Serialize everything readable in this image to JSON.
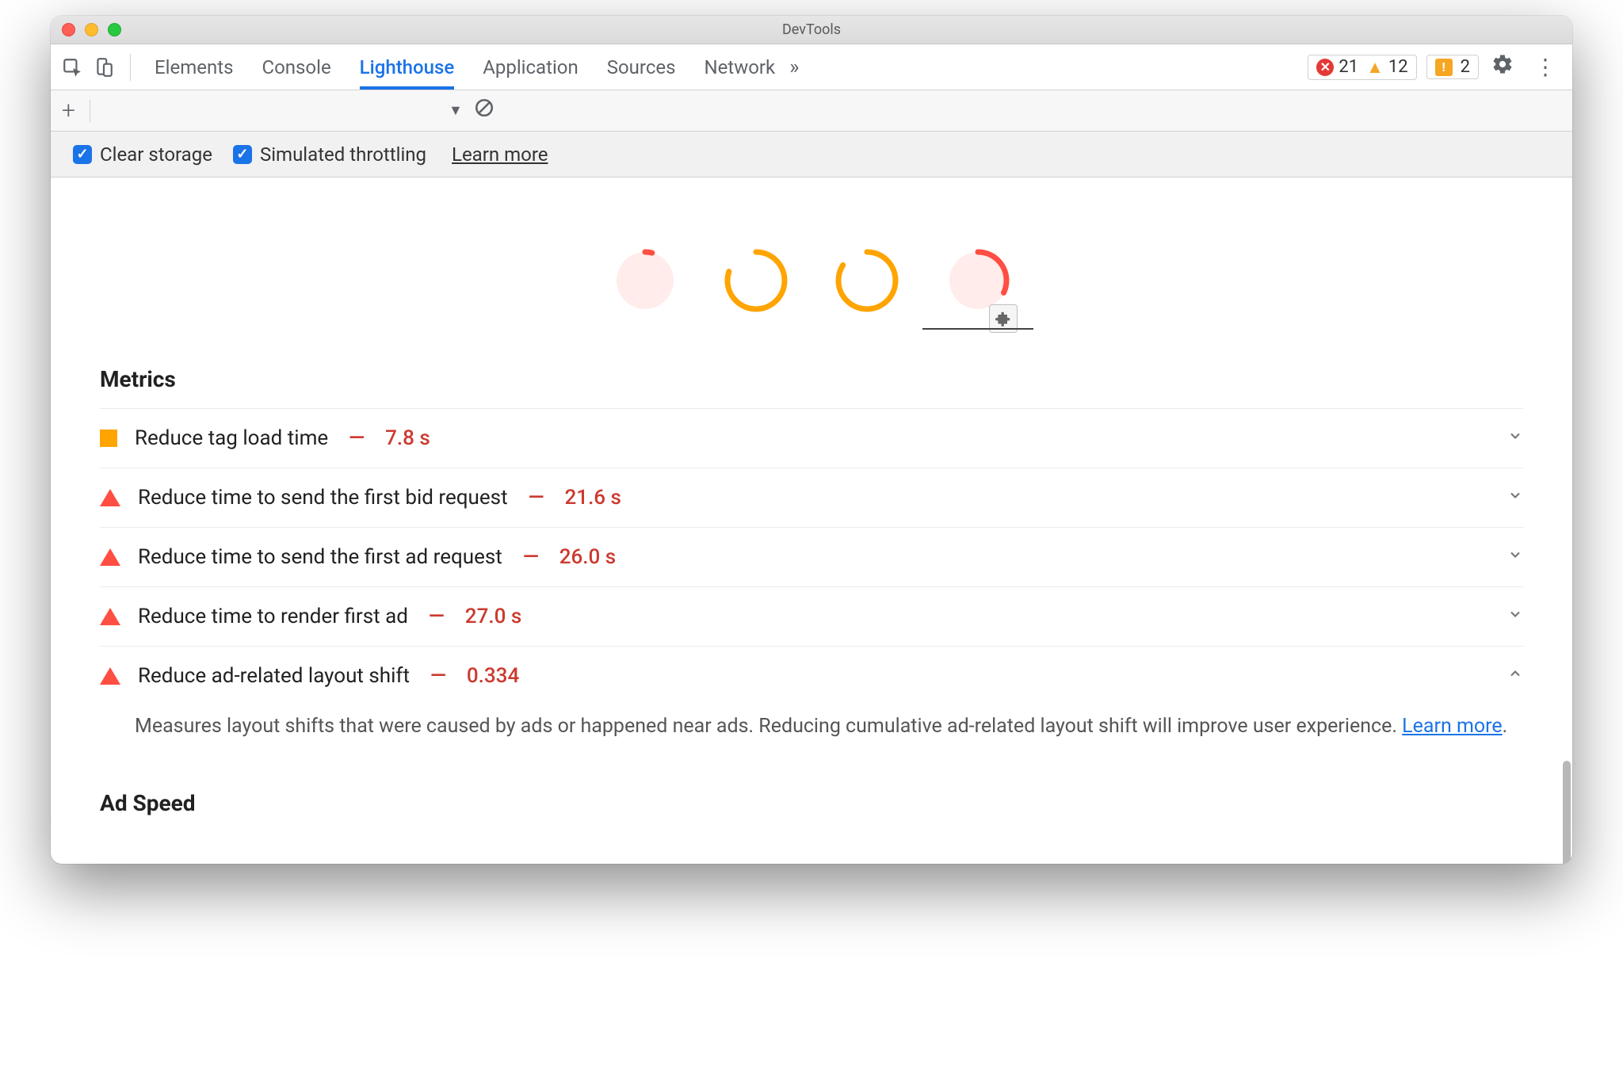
{
  "window": {
    "title": "DevTools"
  },
  "tabs": {
    "items": [
      "Elements",
      "Console",
      "Lighthouse",
      "Application",
      "Sources",
      "Network"
    ],
    "active_index": 2
  },
  "status": {
    "errors": "21",
    "warnings": "12",
    "issues": "2"
  },
  "options": {
    "clear_storage": "Clear storage",
    "simulated_throttling": "Simulated throttling",
    "learn_more": "Learn more"
  },
  "scores": [
    {
      "value": "4",
      "level": "red",
      "pct": 4
    },
    {
      "value": "80",
      "level": "orange",
      "pct": 80
    },
    {
      "value": "84",
      "level": "orange",
      "pct": 84
    },
    {
      "value": "32",
      "level": "red",
      "pct": 32,
      "plugin": true,
      "selected": true
    }
  ],
  "sections": {
    "metrics_title": "Metrics",
    "ad_speed_title": "Ad Speed"
  },
  "metrics": [
    {
      "icon": "square",
      "label": "Reduce tag load time",
      "value": "7.8 s",
      "expanded": false
    },
    {
      "icon": "triangle",
      "label": "Reduce time to send the first bid request",
      "value": "21.6 s",
      "expanded": false
    },
    {
      "icon": "triangle",
      "label": "Reduce time to send the first ad request",
      "value": "26.0 s",
      "expanded": false
    },
    {
      "icon": "triangle",
      "label": "Reduce time to render first ad",
      "value": "27.0 s",
      "expanded": false
    },
    {
      "icon": "triangle",
      "label": "Reduce ad-related layout shift",
      "value": "0.334",
      "expanded": true,
      "description": "Measures layout shifts that were caused by ads or happened near ads. Reducing cumulative ad-related layout shift will improve user experience. ",
      "description_link": "Learn more"
    }
  ],
  "colors": {
    "red": "#ff4e42",
    "orange": "#ffa400",
    "blue": "#1a73e8"
  }
}
